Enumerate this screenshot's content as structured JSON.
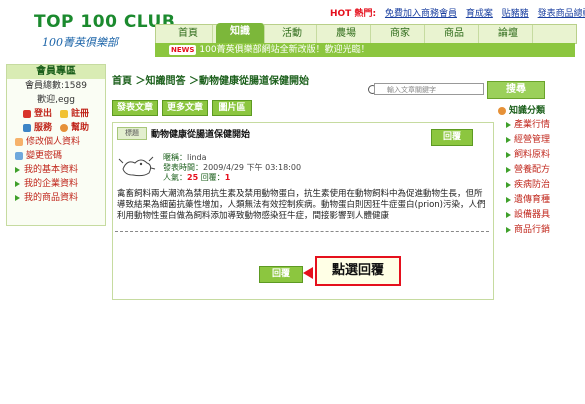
{
  "logo": {
    "main": "TOP 100 CLUB",
    "sub": "100菁英俱樂部"
  },
  "hot": {
    "label": "HOT 熱門:",
    "links": [
      "免費加入商務會員",
      "育成案",
      "贴豬豬",
      "發表商品總動"
    ]
  },
  "nav": {
    "tabs": [
      "首頁",
      "知識",
      "活動",
      "農場",
      "商家",
      "商品",
      "論壇"
    ],
    "active": "知識"
  },
  "news": {
    "badge": "NEWS",
    "text": "100菁英俱樂部網站全新改版！歡迎光臨！"
  },
  "sidebar": {
    "header": "會員專區",
    "member_count": "會員總數:1589",
    "username": "歡迎,egg",
    "links": {
      "logout": "登出",
      "register": "註冊",
      "service": "服務",
      "help": "幫助"
    },
    "items": [
      "修改個人資料",
      "變更密碼"
    ],
    "bullets": [
      "我的基本資料",
      "我的企業資料",
      "我的商品資料"
    ]
  },
  "breadcrumb": "首頁 ＞知識問答 ＞動物健康從腸道保健開始",
  "search": {
    "placeholder": "輸入文章關鍵字",
    "button": "搜尋"
  },
  "tabs": [
    "發表文章",
    "更多文章",
    "圖片區"
  ],
  "post": {
    "badge": "標題",
    "title": "動物健康從腸道保健開始",
    "reply_top": "回覆",
    "nickname_label": "暱稱：",
    "nickname": "linda",
    "time_label": "發表時間：",
    "time": "2009/4/29 下午 03:18:00",
    "popularity_label": "人氣：",
    "popularity": "25",
    "replies_label": "回覆：",
    "replies": "1",
    "body": "禽畜飼料兩大潮流為禁用抗生素及禁用動物蛋白，抗生素使用在動物飼料中為促進動物生長，但所導致結果為細菌抗藥性增加，人類無法有效控制疾病。動物蛋白則因狂牛症蛋白(prion)污染，人們利用動物性蛋白做為飼料添加導致動物感染狂牛症，間接影響到人體健康",
    "reply_bottom": "回覆",
    "callout": "點選回覆"
  },
  "right": {
    "header": "知識分類",
    "items": [
      "產業行情",
      "經營管理",
      "飼料原料",
      "營養配方",
      "疾病防治",
      "遺傳育種",
      "設備器具",
      "商品行銷"
    ]
  },
  "colors": {
    "accent": "#8cc63f",
    "brand_green": "#1b8a2e",
    "hot_red": "#e5101d"
  }
}
